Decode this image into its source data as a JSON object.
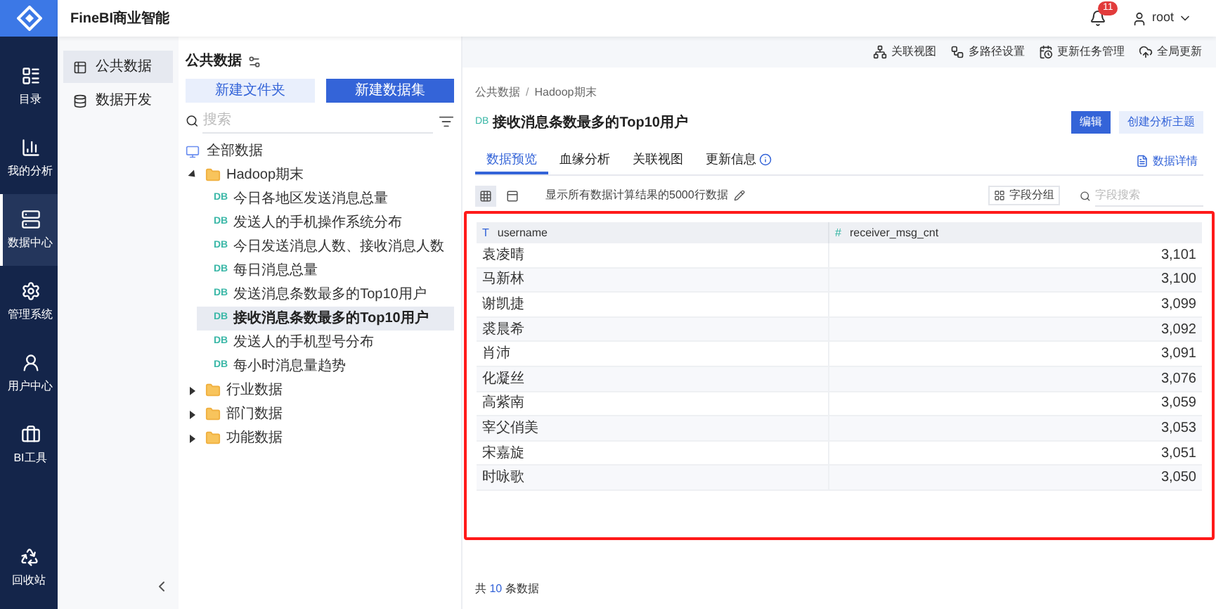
{
  "app": {
    "title": "FineBI商业智能"
  },
  "nav": [
    {
      "label": "目录",
      "kind": "catalog",
      "selected": false
    },
    {
      "label": "我的分析",
      "kind": "analysis",
      "selected": false
    },
    {
      "label": "数据中心",
      "kind": "data",
      "selected": true
    },
    {
      "label": "管理系统",
      "kind": "admin",
      "selected": false
    },
    {
      "label": "用户中心",
      "kind": "user",
      "selected": false
    },
    {
      "label": "BI工具",
      "kind": "tools",
      "selected": false
    }
  ],
  "nav_bottom": {
    "label": "回收站"
  },
  "header": {
    "notification_count": "11",
    "user": "root"
  },
  "section_menu": [
    {
      "label": "公共数据",
      "kind": "public",
      "selected": true
    },
    {
      "label": "数据开发",
      "kind": "dev",
      "selected": false
    }
  ],
  "tree_panel": {
    "title": "公共数据",
    "buttons": [
      {
        "label": "新建文件夹",
        "kind": "secondary"
      },
      {
        "label": "新建数据集",
        "kind": "primary"
      }
    ],
    "search": {
      "placeholder": "搜索"
    }
  },
  "tree": {
    "label": "全部数据",
    "children": [
      {
        "label": "Hadoop期末",
        "expanded": true,
        "children": [
          {
            "badge": "DB",
            "label": "今日各地区发送消息总量",
            "selected": false
          },
          {
            "badge": "DB",
            "label": "发送人的手机操作系统分布",
            "selected": false
          },
          {
            "badge": "DB",
            "label": "今日发送消息人数、接收消息人数",
            "selected": false
          },
          {
            "badge": "DB",
            "label": "每日消息总量",
            "selected": false
          },
          {
            "badge": "DB",
            "label": "发送消息条数最多的Top10用户",
            "selected": false
          },
          {
            "badge": "DB",
            "label": "接收消息条数最多的Top10用户",
            "selected": true
          },
          {
            "badge": "DB",
            "label": "发送人的手机型号分布",
            "selected": false
          },
          {
            "badge": "DB",
            "label": "每小时消息量趋势",
            "selected": false
          }
        ]
      },
      {
        "label": "行业数据",
        "expanded": false
      },
      {
        "label": "部门数据",
        "expanded": false
      },
      {
        "label": "功能数据",
        "expanded": false
      }
    ]
  },
  "top_toolbar": [
    {
      "label": "关联视图",
      "kind": "relation"
    },
    {
      "label": "多路径设置",
      "kind": "paths"
    },
    {
      "label": "更新任务管理",
      "kind": "tasks"
    },
    {
      "label": "全局更新",
      "kind": "update"
    }
  ],
  "breadcrumb": {
    "items": [
      "公共数据",
      "Hadoop期末"
    ],
    "separator": "/"
  },
  "dataset": {
    "badge": "DB",
    "title": "接收消息条数最多的Top10用户",
    "actions": [
      {
        "label": "编辑",
        "kind": "primary"
      },
      {
        "label": "创建分析主题",
        "kind": "secondary"
      }
    ]
  },
  "tabs": [
    {
      "label": "数据预览",
      "selected": true
    },
    {
      "label": "血缘分析",
      "selected": false
    },
    {
      "label": "关联视图",
      "selected": false
    },
    {
      "label": "更新信息",
      "selected": false
    }
  ],
  "details_link": "数据详情",
  "view_modes": [
    {
      "kind": "grid",
      "selected": true
    },
    {
      "kind": "form",
      "selected": false
    }
  ],
  "preview_note": "显示所有数据计算结果的5000行数据",
  "field_group": "字段分组",
  "field_search": {
    "placeholder": "字段搜索"
  },
  "table": {
    "columns": [
      {
        "name": "username",
        "kind": "text",
        "glyph": "T"
      },
      {
        "name": "receiver_msg_cnt",
        "kind": "number",
        "glyph": "#"
      }
    ],
    "rows": [
      [
        "袁凌晴",
        "3,101"
      ],
      [
        "马新林",
        "3,100"
      ],
      [
        "谢凯捷",
        "3,099"
      ],
      [
        "裘晨希",
        "3,092"
      ],
      [
        "肖沛",
        "3,091"
      ],
      [
        "化凝丝",
        "3,076"
      ],
      [
        "高紫南",
        "3,059"
      ],
      [
        "宰父俏美",
        "3,053"
      ],
      [
        "宋嘉旋",
        "3,051"
      ],
      [
        "时咏歌",
        "3,050"
      ]
    ]
  },
  "footer": {
    "prefix": "共",
    "count": "10",
    "suffix": "条数据"
  }
}
